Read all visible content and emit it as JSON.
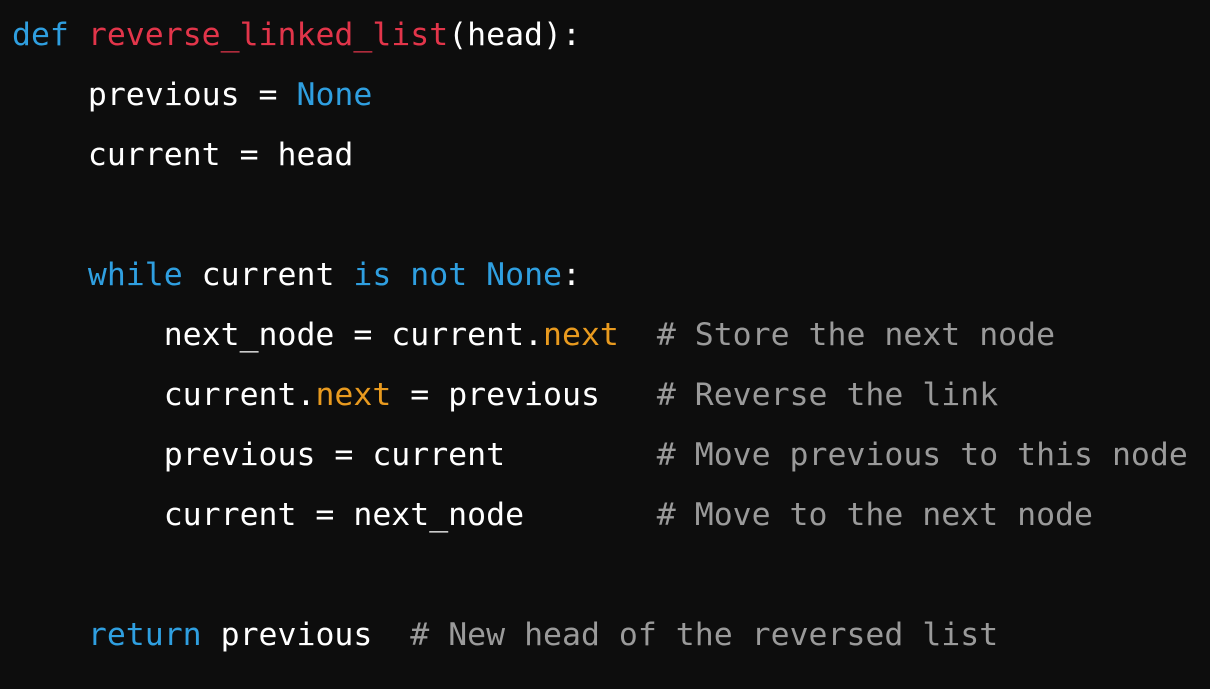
{
  "code": {
    "language": "python",
    "colors": {
      "background": "#0d0d0d",
      "keyword": "#2f9fe0",
      "function_name": "#e2354a",
      "attribute": "#e89a1f",
      "comment": "#9a9a9a",
      "plain": "#ffffff"
    },
    "lines": [
      [
        {
          "type": "keyword",
          "text": "def"
        },
        {
          "type": "plain",
          "text": " "
        },
        {
          "type": "funcname",
          "text": "reverse_linked_list"
        },
        {
          "type": "plain",
          "text": "(head):"
        }
      ],
      [
        {
          "type": "plain",
          "text": "    previous = "
        },
        {
          "type": "keyword",
          "text": "None"
        }
      ],
      [
        {
          "type": "plain",
          "text": "    current = head"
        }
      ],
      [],
      [
        {
          "type": "plain",
          "text": "    "
        },
        {
          "type": "keyword",
          "text": "while"
        },
        {
          "type": "plain",
          "text": " current "
        },
        {
          "type": "keyword",
          "text": "is"
        },
        {
          "type": "plain",
          "text": " "
        },
        {
          "type": "keyword",
          "text": "not"
        },
        {
          "type": "plain",
          "text": " "
        },
        {
          "type": "keyword",
          "text": "None"
        },
        {
          "type": "plain",
          "text": ":"
        }
      ],
      [
        {
          "type": "plain",
          "text": "        next_node = current."
        },
        {
          "type": "attr",
          "text": "next"
        },
        {
          "type": "plain",
          "text": "  "
        },
        {
          "type": "comment",
          "text": "# Store the next node"
        }
      ],
      [
        {
          "type": "plain",
          "text": "        current."
        },
        {
          "type": "attr",
          "text": "next"
        },
        {
          "type": "plain",
          "text": " = previous   "
        },
        {
          "type": "comment",
          "text": "# Reverse the link"
        }
      ],
      [
        {
          "type": "plain",
          "text": "        previous = current        "
        },
        {
          "type": "comment",
          "text": "# Move previous to this node"
        }
      ],
      [
        {
          "type": "plain",
          "text": "        current = next_node       "
        },
        {
          "type": "comment",
          "text": "# Move to the next node"
        }
      ],
      [],
      [
        {
          "type": "plain",
          "text": "    "
        },
        {
          "type": "keyword",
          "text": "return"
        },
        {
          "type": "plain",
          "text": " previous  "
        },
        {
          "type": "comment",
          "text": "# New head of the reversed list"
        }
      ]
    ]
  }
}
